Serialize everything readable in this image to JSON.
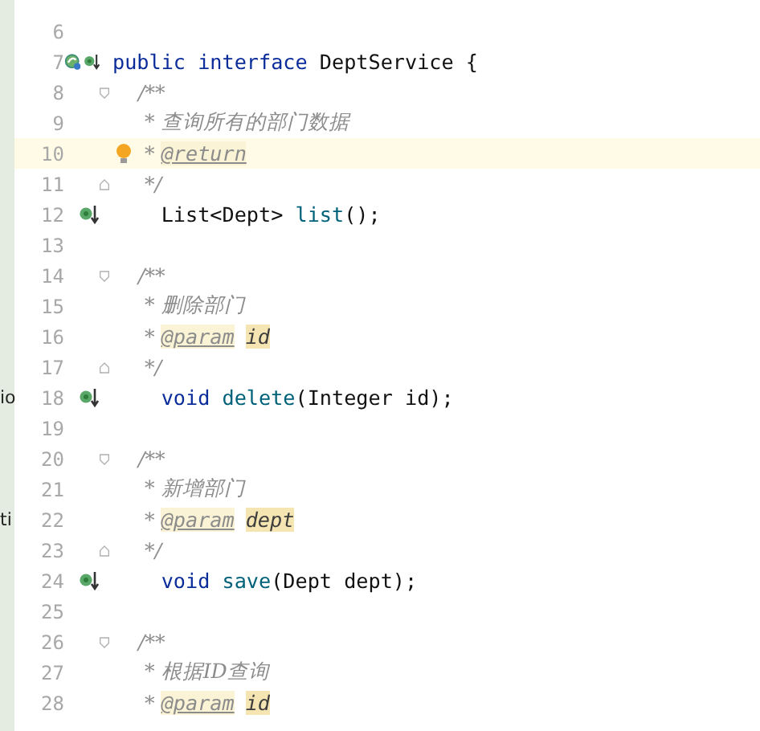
{
  "editor": {
    "lines": [
      {
        "number": "6"
      },
      {
        "number": "7",
        "bean": true,
        "implemented": true,
        "tokens": [
          {
            "kind": "keyword",
            "text": "public interface "
          },
          {
            "kind": "plain",
            "text": "DeptService {"
          }
        ]
      },
      {
        "number": "8",
        "fold_start": true,
        "tokens": [
          {
            "kind": "comment",
            "text": "    /**"
          }
        ]
      },
      {
        "number": "9",
        "tokens": [
          {
            "kind": "comment",
            "text": "     * 查询所有的部门数据"
          }
        ]
      },
      {
        "number": "10",
        "current": true,
        "bulb": true,
        "tokens": [
          {
            "kind": "comment",
            "text": "     * "
          },
          {
            "kind": "doc_tag",
            "text": "@return"
          }
        ]
      },
      {
        "number": "11",
        "fold_end": true,
        "tokens": [
          {
            "kind": "comment",
            "text": "     */"
          }
        ]
      },
      {
        "number": "12",
        "implemented": true,
        "tokens": [
          {
            "kind": "plain",
            "text": "    List<Dept> "
          },
          {
            "kind": "method",
            "text": "list"
          },
          {
            "kind": "plain",
            "text": "();"
          }
        ]
      },
      {
        "number": "13"
      },
      {
        "number": "14",
        "fold_start": true,
        "tokens": [
          {
            "kind": "comment",
            "text": "    /**"
          }
        ]
      },
      {
        "number": "15",
        "tokens": [
          {
            "kind": "comment",
            "text": "     * 删除部门"
          }
        ]
      },
      {
        "number": "16",
        "tokens": [
          {
            "kind": "comment",
            "text": "     * "
          },
          {
            "kind": "doc_tag",
            "text": "@param"
          },
          {
            "kind": "doc_param",
            "text": "id"
          }
        ]
      },
      {
        "number": "17",
        "fold_end": true,
        "tokens": [
          {
            "kind": "comment",
            "text": "     */"
          }
        ]
      },
      {
        "number": "18",
        "implemented": true,
        "side_text": "io",
        "tokens": [
          {
            "kind": "keyword",
            "text": "    void "
          },
          {
            "kind": "method",
            "text": "delete"
          },
          {
            "kind": "plain",
            "text": "(Integer id);"
          }
        ]
      },
      {
        "number": "19"
      },
      {
        "number": "20",
        "fold_start": true,
        "tokens": [
          {
            "kind": "comment",
            "text": "    /**"
          }
        ]
      },
      {
        "number": "21",
        "tokens": [
          {
            "kind": "comment",
            "text": "     * 新增部门"
          }
        ]
      },
      {
        "number": "22",
        "side_text": "ti",
        "tokens": [
          {
            "kind": "comment",
            "text": "     * "
          },
          {
            "kind": "doc_tag",
            "text": "@param"
          },
          {
            "kind": "doc_param",
            "text": "dept"
          }
        ]
      },
      {
        "number": "23",
        "fold_end": true,
        "tokens": [
          {
            "kind": "comment",
            "text": "     */"
          }
        ]
      },
      {
        "number": "24",
        "implemented": true,
        "tokens": [
          {
            "kind": "keyword",
            "text": "    void "
          },
          {
            "kind": "method",
            "text": "save"
          },
          {
            "kind": "plain",
            "text": "(Dept dept);"
          }
        ]
      },
      {
        "number": "25"
      },
      {
        "number": "26",
        "fold_start": true,
        "tokens": [
          {
            "kind": "comment",
            "text": "    /**"
          }
        ]
      },
      {
        "number": "27",
        "tokens": [
          {
            "kind": "comment",
            "text": "     * 根据ID查询"
          }
        ]
      },
      {
        "number": "28",
        "tokens": [
          {
            "kind": "comment",
            "text": "     * "
          },
          {
            "kind": "doc_tag",
            "text": "@param"
          },
          {
            "kind": "doc_param",
            "text": "id"
          }
        ]
      }
    ]
  }
}
